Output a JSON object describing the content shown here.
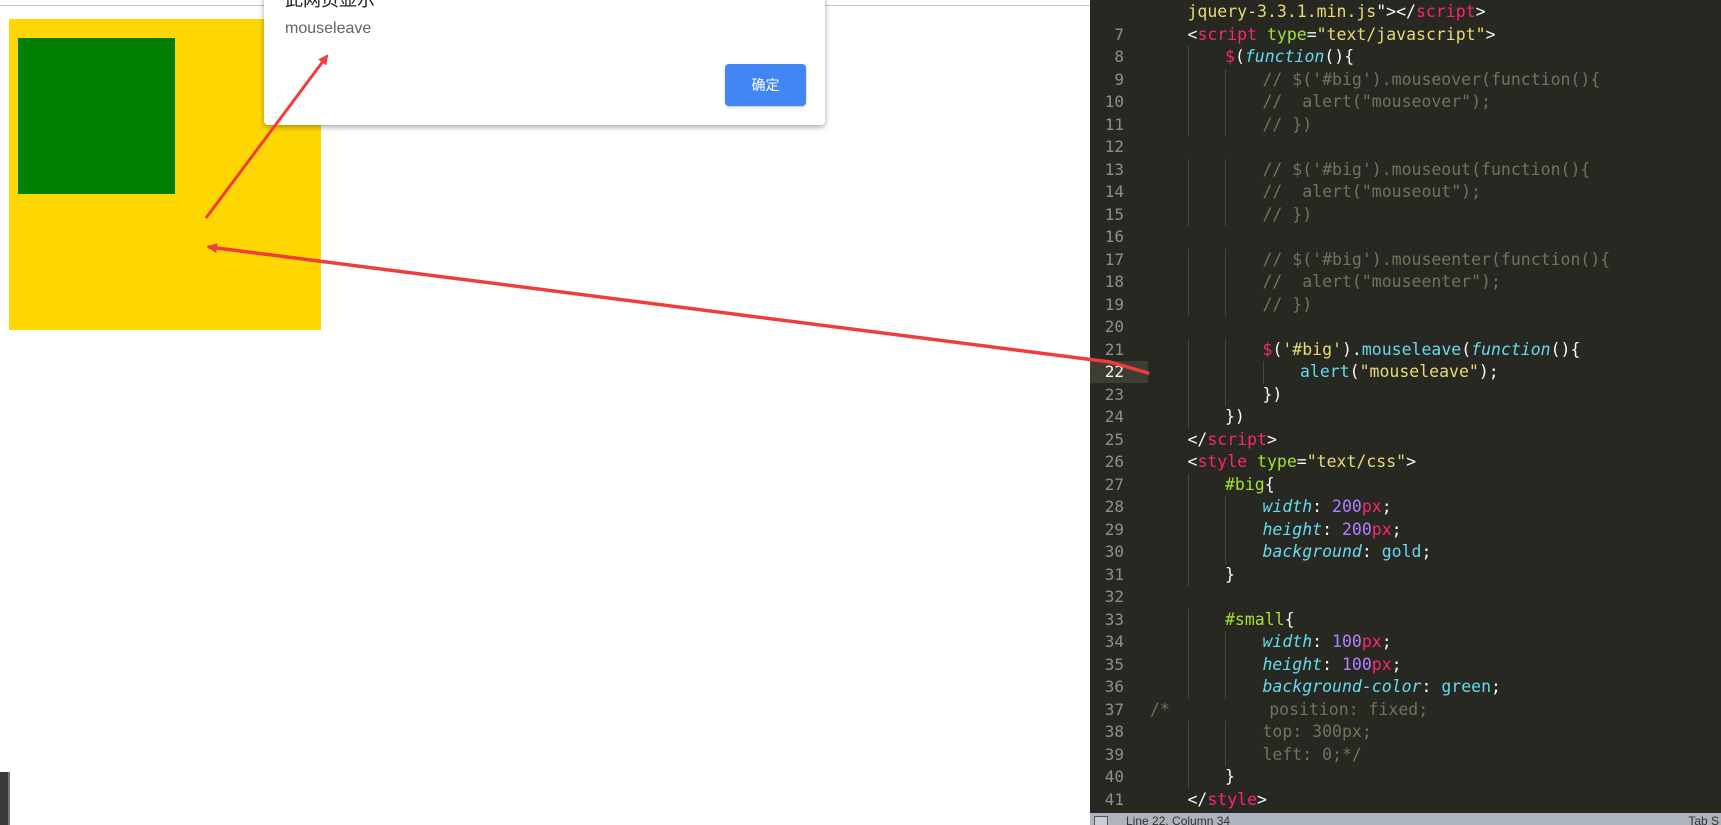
{
  "browser": {
    "dialog": {
      "title": "此网页显示",
      "message": "mouseleave",
      "ok_label": "确定"
    },
    "big_box_color": "#ffd700",
    "small_box_color": "#008000"
  },
  "editor": {
    "lines": [
      {
        "num": "7",
        "indent": 1,
        "tokens": [
          [
            "t-plain",
            "<"
          ],
          [
            "t-tag",
            "script"
          ],
          [
            "t-plain",
            " "
          ],
          [
            "t-attr",
            "type"
          ],
          [
            "t-plain",
            "="
          ],
          [
            "t-str",
            "\"text/javascript\""
          ],
          [
            "t-plain",
            ">"
          ]
        ]
      },
      {
        "num": "8",
        "indent": 2,
        "tokens": [
          [
            "t-tag",
            "$"
          ],
          [
            "t-plain",
            "("
          ],
          [
            "t-kw-it",
            "function"
          ],
          [
            "t-plain",
            "(){"
          ]
        ]
      },
      {
        "num": "9",
        "indent": 3,
        "tokens": [
          [
            "t-comment",
            "// $('#big').mouseover(function(){"
          ]
        ]
      },
      {
        "num": "10",
        "indent": 3,
        "tokens": [
          [
            "t-comment",
            "//  alert(\"mouseover\");"
          ]
        ]
      },
      {
        "num": "11",
        "indent": 3,
        "tokens": [
          [
            "t-comment",
            "// })"
          ]
        ]
      },
      {
        "num": "12",
        "indent": 0,
        "tokens": []
      },
      {
        "num": "13",
        "indent": 3,
        "tokens": [
          [
            "t-comment",
            "// $('#big').mouseout(function(){"
          ]
        ]
      },
      {
        "num": "14",
        "indent": 3,
        "tokens": [
          [
            "t-comment",
            "//  alert(\"mouseout\");"
          ]
        ]
      },
      {
        "num": "15",
        "indent": 3,
        "tokens": [
          [
            "t-comment",
            "// })"
          ]
        ]
      },
      {
        "num": "16",
        "indent": 0,
        "tokens": []
      },
      {
        "num": "17",
        "indent": 3,
        "tokens": [
          [
            "t-comment",
            "// $('#big').mouseenter(function(){"
          ]
        ]
      },
      {
        "num": "18",
        "indent": 3,
        "tokens": [
          [
            "t-comment",
            "//  alert(\"mouseenter\");"
          ]
        ]
      },
      {
        "num": "19",
        "indent": 3,
        "tokens": [
          [
            "t-comment",
            "// })"
          ]
        ]
      },
      {
        "num": "20",
        "indent": 0,
        "tokens": []
      },
      {
        "num": "21",
        "indent": 3,
        "tokens": [
          [
            "t-tag",
            "$"
          ],
          [
            "t-plain",
            "("
          ],
          [
            "t-str",
            "'#big'"
          ],
          [
            "t-plain",
            ")."
          ],
          [
            "t-fn",
            "mouseleave"
          ],
          [
            "t-plain",
            "("
          ],
          [
            "t-kw-it",
            "function"
          ],
          [
            "t-plain",
            "(){"
          ]
        ]
      },
      {
        "num": "22",
        "indent": 4,
        "active": true,
        "tokens": [
          [
            "t-fn",
            "alert"
          ],
          [
            "t-plain",
            "("
          ],
          [
            "t-str",
            "\"mouseleave\""
          ],
          [
            "t-plain",
            ");"
          ]
        ]
      },
      {
        "num": "23",
        "indent": 3,
        "tokens": [
          [
            "t-plain",
            "})"
          ]
        ]
      },
      {
        "num": "24",
        "indent": 2,
        "tokens": [
          [
            "t-plain",
            "})"
          ]
        ]
      },
      {
        "num": "25",
        "indent": 1,
        "tokens": [
          [
            "t-plain",
            "</"
          ],
          [
            "t-tag",
            "script"
          ],
          [
            "t-plain",
            ">"
          ]
        ]
      },
      {
        "num": "26",
        "indent": 1,
        "tokens": [
          [
            "t-plain",
            "<"
          ],
          [
            "t-tag",
            "style"
          ],
          [
            "t-plain",
            " "
          ],
          [
            "t-attr",
            "type"
          ],
          [
            "t-plain",
            "="
          ],
          [
            "t-str",
            "\"text/css\""
          ],
          [
            "t-plain",
            ">"
          ]
        ]
      },
      {
        "num": "27",
        "indent": 2,
        "tokens": [
          [
            "t-sel",
            "#big"
          ],
          [
            "t-plain",
            "{"
          ]
        ]
      },
      {
        "num": "28",
        "indent": 3,
        "tokens": [
          [
            "t-kw-it",
            "width"
          ],
          [
            "t-plain",
            ": "
          ],
          [
            "t-num",
            "200"
          ],
          [
            "t-unit",
            "px"
          ],
          [
            "t-plain",
            ";"
          ]
        ]
      },
      {
        "num": "29",
        "indent": 3,
        "tokens": [
          [
            "t-kw-it",
            "height"
          ],
          [
            "t-plain",
            ": "
          ],
          [
            "t-num",
            "200"
          ],
          [
            "t-unit",
            "px"
          ],
          [
            "t-plain",
            ";"
          ]
        ]
      },
      {
        "num": "30",
        "indent": 3,
        "tokens": [
          [
            "t-kw-it",
            "background"
          ],
          [
            "t-plain",
            ": "
          ],
          [
            "t-val",
            "gold"
          ],
          [
            "t-plain",
            ";"
          ]
        ]
      },
      {
        "num": "31",
        "indent": 2,
        "tokens": [
          [
            "t-plain",
            "}"
          ]
        ]
      },
      {
        "num": "32",
        "indent": 0,
        "tokens": []
      },
      {
        "num": "33",
        "indent": 2,
        "tokens": [
          [
            "t-sel",
            "#small"
          ],
          [
            "t-plain",
            "{"
          ]
        ]
      },
      {
        "num": "34",
        "indent": 3,
        "tokens": [
          [
            "t-kw-it",
            "width"
          ],
          [
            "t-plain",
            ": "
          ],
          [
            "t-num",
            "100"
          ],
          [
            "t-unit",
            "px"
          ],
          [
            "t-plain",
            ";"
          ]
        ]
      },
      {
        "num": "35",
        "indent": 3,
        "tokens": [
          [
            "t-kw-it",
            "height"
          ],
          [
            "t-plain",
            ": "
          ],
          [
            "t-num",
            "100"
          ],
          [
            "t-unit",
            "px"
          ],
          [
            "t-plain",
            ";"
          ]
        ]
      },
      {
        "num": "36",
        "indent": 3,
        "tokens": [
          [
            "t-kw-it",
            "background-color"
          ],
          [
            "t-plain",
            ": "
          ],
          [
            "t-val",
            "green"
          ],
          [
            "t-plain",
            ";"
          ]
        ]
      },
      {
        "num": "37",
        "indent": 0,
        "tokens": [
          [
            "t-comment",
            "/*          position: fixed;"
          ]
        ]
      },
      {
        "num": "38",
        "indent": 3,
        "tokens": [
          [
            "t-comment",
            "top: 300px;"
          ]
        ]
      },
      {
        "num": "39",
        "indent": 3,
        "tokens": [
          [
            "t-comment",
            "left: 0;*/"
          ]
        ]
      },
      {
        "num": "40",
        "indent": 2,
        "tokens": [
          [
            "t-plain",
            "}"
          ]
        ]
      },
      {
        "num": "41",
        "indent": 1,
        "tokens": [
          [
            "t-plain",
            "</"
          ],
          [
            "t-tag",
            "style"
          ],
          [
            "t-plain",
            ">"
          ]
        ]
      }
    ],
    "top_partial_line": {
      "indent": 1,
      "tokens": [
        [
          "t-str",
          "jquery-3.3.1.min.js"
        ],
        [
          "t-plain",
          "\">"
        ],
        [
          "t-plain",
          "</"
        ],
        [
          "t-tag",
          "script"
        ],
        [
          "t-plain",
          ">"
        ]
      ]
    },
    "status": {
      "position_text": "Line 22, Column 34",
      "tab_text": "Tab S"
    }
  },
  "colors": {
    "editor_bg": "#272822",
    "annotation_arrow": "#f03c3c"
  }
}
